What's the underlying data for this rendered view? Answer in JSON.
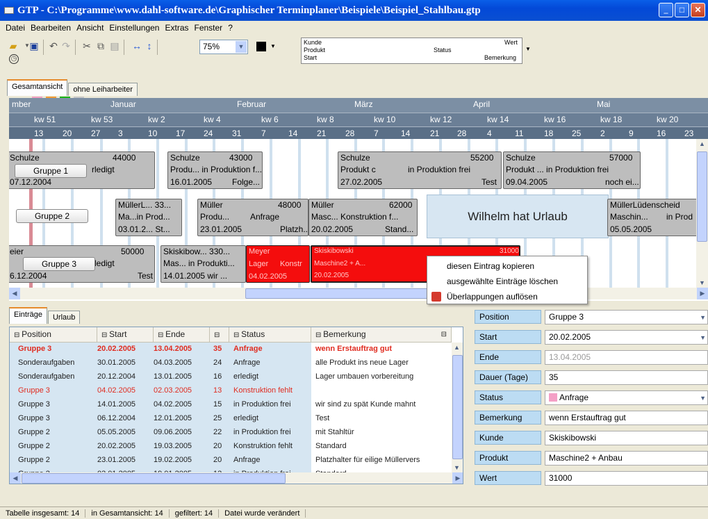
{
  "window": {
    "title": "GTP - C:\\Programme\\www.dahl-software.de\\Graphischer Terminplaner\\Beispiele\\Beispiel_Stahlbau.gtp"
  },
  "menu": [
    "Datei",
    "Bearbeiten",
    "Ansicht",
    "Einstellungen",
    "Extras",
    "Fenster",
    "?"
  ],
  "toolbar": {
    "zoom": "75%",
    "legend": {
      "kunde": "Kunde",
      "produkt": "Produkt",
      "start": "Start",
      "status": "Status",
      "wert": "Wert",
      "bemerkung": "Bemerkung"
    }
  },
  "view_tabs": [
    "Gesamtansicht",
    "ohne Leiharbeiter"
  ],
  "gantt": {
    "months": [
      "mber",
      "Januar",
      "Februar",
      "März",
      "April",
      "Mai"
    ],
    "weeks": [
      "kw 51",
      "kw 53",
      "kw 2",
      "kw 4",
      "kw 6",
      "kw 8",
      "kw 10",
      "kw 12",
      "kw 14",
      "kw 16",
      "kw 18",
      "kw 20"
    ],
    "days": [
      "13",
      "20",
      "27",
      "3",
      "10",
      "17",
      "24",
      "31",
      "7",
      "14",
      "21",
      "28",
      "7",
      "14",
      "21",
      "28",
      "4",
      "11",
      "18",
      "25",
      "2",
      "9",
      "16",
      "23"
    ],
    "groups": [
      "Gruppe 1",
      "Gruppe 2",
      "Gruppe 3"
    ],
    "bars": {
      "b1": {
        "l1": "Schulze",
        "v": "44000",
        "l2": "rledigt",
        "l3": "07.12.2004"
      },
      "b2": {
        "l1": "Schulze",
        "v": "43000",
        "l2": "Produ... in Produktion f...",
        "l3": "16.01.2005",
        "l4": "Folge..."
      },
      "b3": {
        "l1": "Schulze",
        "v": "55200",
        "l2": "Produkt c",
        "l2b": "in Produktion frei",
        "l3": "27.02.2005",
        "l4": "Test"
      },
      "b4": {
        "l1": "Schulze",
        "v": "57000",
        "l2": "Produkt ...  in Produktion frei",
        "l3": "09.04.2005",
        "l4": "noch ei..."
      },
      "b5": {
        "l1": "MüllerL... 33...",
        "l2": "Ma...in Prod...",
        "l3": "03.01.2... St..."
      },
      "b6": {
        "l1": "Müller",
        "v": "48000",
        "l2": "Produ...",
        "l2b": "Anfrage",
        "l3": "23.01.2005",
        "l4": "Platzh..."
      },
      "b7": {
        "l1": "Müller",
        "v": "62000",
        "l2": "Masc...  Konstruktion f...",
        "l3": "20.02.2005",
        "l4": "Stand..."
      },
      "b8": {
        "l1": "MüllerLüdenscheid",
        "l2": "Maschin...",
        "l2b": "in Prod",
        "l3": "05.05.2005"
      },
      "b9": {
        "l1": "eier",
        "v": "50000",
        "l2": "rledigt",
        "l3": "6.12.2004",
        "l4": "Test"
      },
      "b10": {
        "l1": "Skiskibow... 330...",
        "l2": "Mas... in Produkti...",
        "l3": "14.01.2005  wir ..."
      },
      "b11": {
        "l1": "Meyer",
        "l2": "Lager",
        "l2b": "Konstr",
        "l3": "04.02.2005"
      },
      "b12": {
        "l1": "Skiskibowski",
        "v": "31000",
        "l2": "Maschine2 + A...",
        "l3": "20.02.2005"
      }
    },
    "vacation": "Wilhelm hat Urlaub"
  },
  "context_menu": [
    "diesen Eintrag kopieren",
    "ausgewählte Einträge löschen",
    "Überlappungen auflösen"
  ],
  "list_tabs": [
    "Einträge",
    "Urlaub"
  ],
  "table": {
    "headers": [
      "Position",
      "Start",
      "Ende",
      "",
      "Status",
      "Bemerkung"
    ],
    "rows": [
      {
        "pos": "Gruppe 3",
        "start": "20.02.2005",
        "end": "13.04.2005",
        "dur": "35",
        "status": "Anfrage",
        "note": "wenn Erstauftrag gut",
        "style": "sel"
      },
      {
        "pos": "Sonderaufgaben",
        "start": "30.01.2005",
        "end": "04.03.2005",
        "dur": "24",
        "status": "Anfrage",
        "note": "alle Produkt ins neue Lager",
        "style": ""
      },
      {
        "pos": "Sonderaufgaben",
        "start": "20.12.2004",
        "end": "13.01.2005",
        "dur": "16",
        "status": "erledigt",
        "note": "Lager umbauen vorbereitung",
        "style": ""
      },
      {
        "pos": "Gruppe 3",
        "start": "04.02.2005",
        "end": "02.03.2005",
        "dur": "13",
        "status": "Konstruktion fehlt",
        "note": "",
        "style": "red"
      },
      {
        "pos": "Gruppe 3",
        "start": "14.01.2005",
        "end": "04.02.2005",
        "dur": "15",
        "status": "in Produktion frei",
        "note": "wir sind zu spät Kunde mahnt",
        "style": ""
      },
      {
        "pos": "Gruppe 3",
        "start": "06.12.2004",
        "end": "12.01.2005",
        "dur": "25",
        "status": "erledigt",
        "note": "Test",
        "style": ""
      },
      {
        "pos": "Gruppe 2",
        "start": "05.05.2005",
        "end": "09.06.2005",
        "dur": "22",
        "status": "in Produktion frei",
        "note": "mit Stahltür",
        "style": ""
      },
      {
        "pos": "Gruppe 2",
        "start": "20.02.2005",
        "end": "19.03.2005",
        "dur": "20",
        "status": "Konstruktion fehlt",
        "note": "Standard",
        "style": ""
      },
      {
        "pos": "Gruppe 2",
        "start": "23.01.2005",
        "end": "19.02.2005",
        "dur": "20",
        "status": "Anfrage",
        "note": "Platzhalter für eilige Müllervers",
        "style": ""
      },
      {
        "pos": "Gruppe 2",
        "start": "03.01.2005",
        "end": "19.01.2005",
        "dur": "12",
        "status": "in Produktion frei",
        "note": "Standard",
        "style": ""
      }
    ]
  },
  "props": [
    {
      "label": "Position",
      "value": "Gruppe 3",
      "dd": true
    },
    {
      "label": "Start",
      "value": "20.02.2005",
      "dd": true
    },
    {
      "label": "Ende",
      "value": "13.04.2005",
      "dd": false,
      "muted": true
    },
    {
      "label": "Dauer (Tage)",
      "value": "35",
      "dd": false
    },
    {
      "label": "Status",
      "value": "Anfrage",
      "dd": true,
      "swatch": "#f4a0c6"
    },
    {
      "label": "Bemerkung",
      "value": "wenn Erstauftrag gut",
      "dd": false
    },
    {
      "label": "Kunde",
      "value": "Skiskibowski",
      "dd": false
    },
    {
      "label": "Produkt",
      "value": "Maschine2 + Anbau",
      "dd": false
    },
    {
      "label": "Wert",
      "value": "31000",
      "dd": false
    }
  ],
  "status": [
    "Tabelle insgesamt: 14",
    "in Gesamtansicht: 14",
    "gefiltert: 14",
    "Datei wurde verändert"
  ]
}
